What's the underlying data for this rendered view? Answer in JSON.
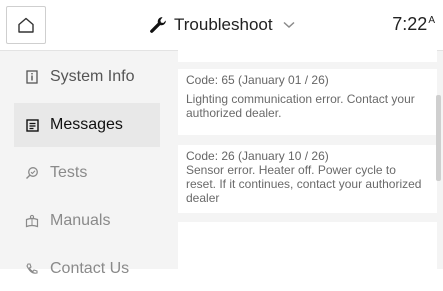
{
  "header": {
    "title": "Troubleshoot",
    "time": "7:22",
    "time_suffix": "A",
    "home_icon": "home-icon",
    "wrench_icon": "wrench-icon",
    "chevron_icon": "chevron-down-icon"
  },
  "sidebar": {
    "items": [
      {
        "label": "System Info",
        "icon": "info-icon"
      },
      {
        "label": "Messages",
        "icon": "message-icon"
      },
      {
        "label": "Tests",
        "icon": "magnify-icon"
      },
      {
        "label": "Manuals",
        "icon": "manual-icon"
      },
      {
        "label": "Contact Us",
        "icon": "contact-icon"
      }
    ]
  },
  "messages": [
    {
      "code": "Code: 65 (January 01 / 26)",
      "text": "Lighting communication error. Contact your authorized dealer."
    },
    {
      "code": "Code: 26 (January 10 / 26)",
      "text": "Sensor error. Heater off. Power cycle to reset. If it continues, contact your authorized dealer"
    }
  ],
  "colors": {
    "background": "#f4f4f4",
    "active_item": "#e8e8e8",
    "card": "#ffffff"
  }
}
